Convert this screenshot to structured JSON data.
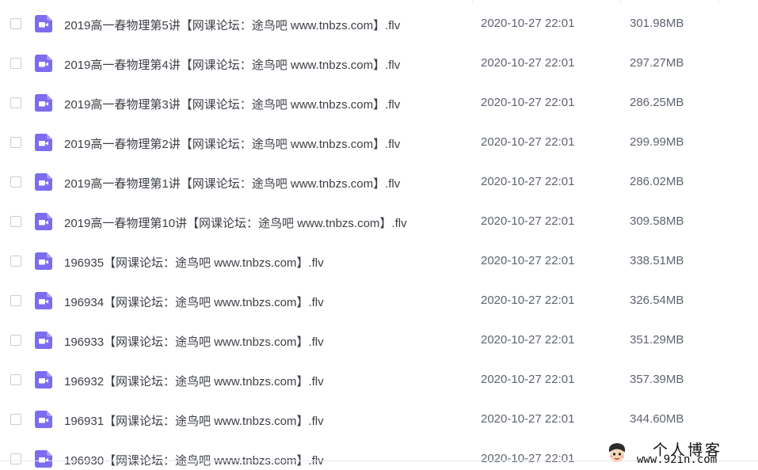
{
  "files": [
    {
      "name": "2019高一春物理第5讲【网课论坛：途鸟吧 www.tnbzs.com】.flv",
      "modified": "2020-10-27 22:01",
      "size": "301.98MB"
    },
    {
      "name": "2019高一春物理第4讲【网课论坛：途鸟吧 www.tnbzs.com】.flv",
      "modified": "2020-10-27 22:01",
      "size": "297.27MB"
    },
    {
      "name": "2019高一春物理第3讲【网课论坛：途鸟吧 www.tnbzs.com】.flv",
      "modified": "2020-10-27 22:01",
      "size": "286.25MB"
    },
    {
      "name": "2019高一春物理第2讲【网课论坛：途鸟吧 www.tnbzs.com】.flv",
      "modified": "2020-10-27 22:01",
      "size": "299.99MB"
    },
    {
      "name": "2019高一春物理第1讲【网课论坛：途鸟吧 www.tnbzs.com】.flv",
      "modified": "2020-10-27 22:01",
      "size": "286.02MB"
    },
    {
      "name": "2019高一春物理第10讲【网课论坛：途鸟吧 www.tnbzs.com】.flv",
      "modified": "2020-10-27 22:01",
      "size": "309.58MB"
    },
    {
      "name": "196935【网课论坛：途鸟吧 www.tnbzs.com】.flv",
      "modified": "2020-10-27 22:01",
      "size": "338.51MB"
    },
    {
      "name": "196934【网课论坛：途鸟吧 www.tnbzs.com】.flv",
      "modified": "2020-10-27 22:01",
      "size": "326.54MB"
    },
    {
      "name": "196933【网课论坛：途鸟吧 www.tnbzs.com】.flv",
      "modified": "2020-10-27 22:01",
      "size": "351.29MB"
    },
    {
      "name": "196932【网课论坛：途鸟吧 www.tnbzs.com】.flv",
      "modified": "2020-10-27 22:01",
      "size": "357.39MB"
    },
    {
      "name": "196931【网课论坛：途鸟吧 www.tnbzs.com】.flv",
      "modified": "2020-10-27 22:01",
      "size": "344.60MB"
    },
    {
      "name": "196930【网课论坛：途鸟吧 www.tnbzs.com】.flv",
      "modified": "2020-10-27 22:01",
      "size": ""
    }
  ],
  "file_icon": "video-file-icon",
  "colors": {
    "icon_purple": "#7b6cf0",
    "text_primary": "#3c3f46",
    "text_secondary": "#5f6470",
    "checkbox_border": "#c9cdd4"
  },
  "watermark": {
    "title": "个人博客",
    "url": "www.92in.com"
  }
}
